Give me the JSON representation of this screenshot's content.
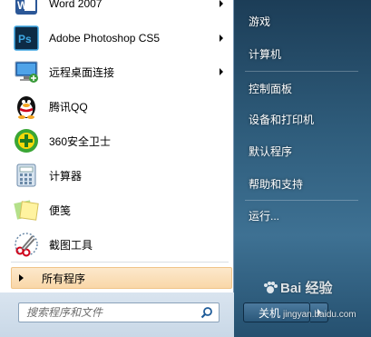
{
  "programs": [
    {
      "label": "Word 2007",
      "icon": "word-icon",
      "has_arrow": true
    },
    {
      "label": "Adobe Photoshop CS5",
      "icon": "photoshop-icon",
      "has_arrow": true
    },
    {
      "label": "远程桌面连接",
      "icon": "remote-desktop-icon",
      "has_arrow": true
    },
    {
      "label": "腾讯QQ",
      "icon": "qq-penguin-icon",
      "has_arrow": false
    },
    {
      "label": "360安全卫士",
      "icon": "360-security-icon",
      "has_arrow": false
    },
    {
      "label": "计算器",
      "icon": "calculator-icon",
      "has_arrow": false
    },
    {
      "label": "便笺",
      "icon": "sticky-notes-icon",
      "has_arrow": false
    },
    {
      "label": "截图工具",
      "icon": "snipping-tool-icon",
      "has_arrow": false
    }
  ],
  "all_programs_label": "所有程序",
  "search": {
    "placeholder": "搜索程序和文件"
  },
  "right_menu": [
    {
      "label": "游戏"
    },
    {
      "label": "计算机"
    },
    {
      "label": "控制面板"
    },
    {
      "label": "设备和打印机"
    },
    {
      "label": "默认程序"
    },
    {
      "label": "帮助和支持"
    },
    {
      "label": "运行..."
    }
  ],
  "shutdown_label": "关机",
  "watermark": {
    "text": "Bai 经验",
    "sub": "jingyan.baidu.com"
  },
  "colors": {
    "accent": "#f9d7a8",
    "panel_bg": "#ffffff",
    "right_bg": "#2f5d7c"
  }
}
